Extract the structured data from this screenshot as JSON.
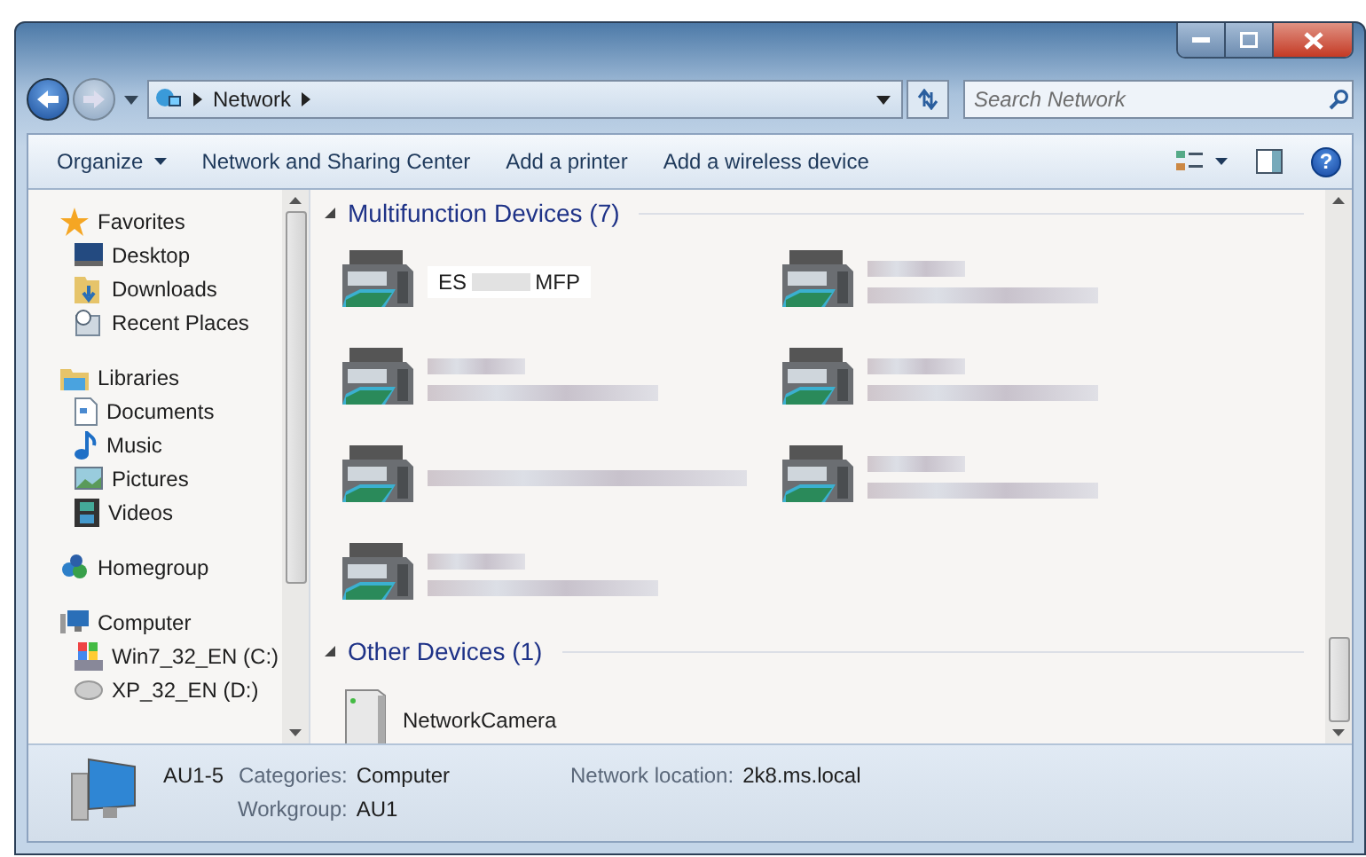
{
  "address": {
    "crumbs": [
      "Network"
    ]
  },
  "search": {
    "placeholder": "Search Network"
  },
  "toolbar": {
    "items": [
      "Organize",
      "Network and Sharing Center",
      "Add a printer",
      "Add a wireless device"
    ],
    "help": "?"
  },
  "sidebar": {
    "groups": [
      {
        "label": "Favorites",
        "children": [
          {
            "label": "Desktop"
          },
          {
            "label": "Downloads"
          },
          {
            "label": "Recent Places"
          }
        ]
      },
      {
        "label": "Libraries",
        "children": [
          {
            "label": "Documents"
          },
          {
            "label": "Music"
          },
          {
            "label": "Pictures"
          },
          {
            "label": "Videos"
          }
        ]
      },
      {
        "label": "Homegroup"
      },
      {
        "label": "Computer",
        "children": [
          {
            "label": "Win7_32_EN (C:)"
          },
          {
            "label": "XP_32_EN (D:)"
          }
        ]
      }
    ]
  },
  "groups": [
    {
      "title": "Multifunction Devices (7)",
      "items": [
        {
          "kind": "partly-hidden",
          "prefix": "ES",
          "suffix": "MFP"
        },
        {
          "kind": "blurred-two-line"
        },
        {
          "kind": "blurred-two-line"
        },
        {
          "kind": "blurred-two-line"
        },
        {
          "kind": "blurred-one-line"
        },
        {
          "kind": "blurred-two-line"
        },
        {
          "kind": "blurred-two-line"
        }
      ]
    },
    {
      "title": "Other Devices (1)",
      "items": [
        {
          "kind": "named",
          "name": "NetworkCamera"
        }
      ]
    }
  ],
  "details": {
    "name": "AU1-5",
    "fields": [
      {
        "label": "Categories:",
        "value": "Computer"
      },
      {
        "label": "Workgroup:",
        "value": "AU1"
      }
    ],
    "extra": {
      "label": "Network location:",
      "value": "2k8.ms.local"
    }
  }
}
